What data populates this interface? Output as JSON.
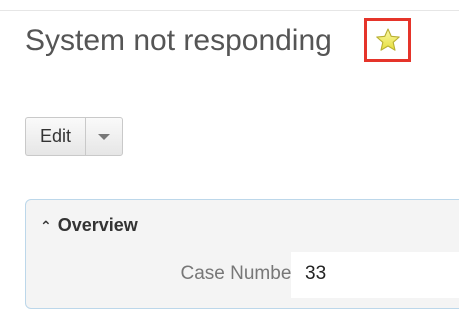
{
  "record": {
    "title": "System not responding",
    "favorite_icon": "star-icon"
  },
  "actions": {
    "edit_label": "Edit",
    "dropdown_icon": "caret-down-icon"
  },
  "panel": {
    "title": "Overview",
    "collapse_icon": "double-chevron-up-icon",
    "fields": [
      {
        "label": "Case Number:",
        "value": "33"
      }
    ]
  },
  "colors": {
    "highlight_border": "#e5342a",
    "star_fill": "#f6f072",
    "panel_border": "#bcd7ea"
  }
}
